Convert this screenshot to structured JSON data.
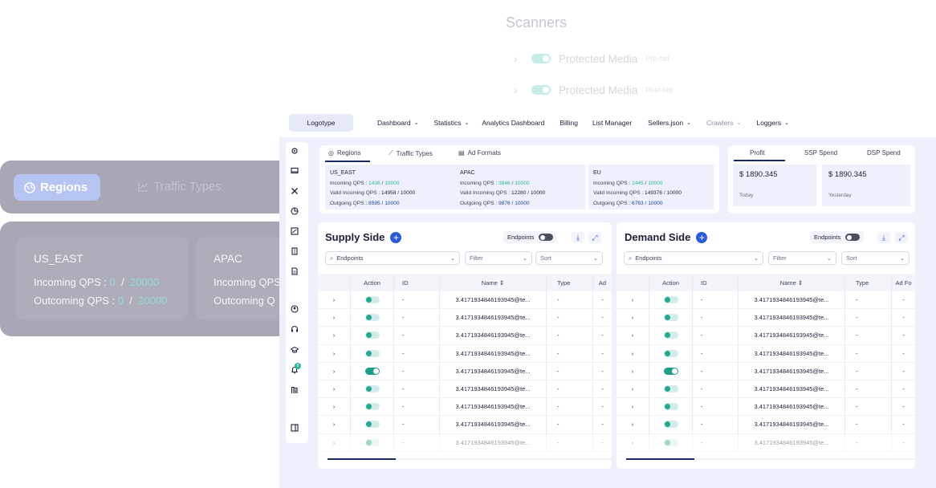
{
  "scanners": {
    "title": "Scanners",
    "rows": [
      {
        "label": "Protected Media",
        "tag": "Pre-bid"
      },
      {
        "label": "Protected Media",
        "tag": "Post-bid"
      }
    ]
  },
  "zoom": {
    "tabs": [
      "Regions",
      "Traffic Types"
    ],
    "cards": [
      {
        "region": "US_EAST",
        "incoming_label": "Incoming QPS :",
        "incoming": "0",
        "incoming_max": "20000",
        "outcoming_label": "Outcoming QPS :",
        "outcoming": "0",
        "outcoming_max": "20000"
      },
      {
        "region": "APAC",
        "incoming_label": "Incoming QPS",
        "outcoming_label": "Outcoming Q"
      }
    ]
  },
  "nav": {
    "logo": "Logotype",
    "items": [
      "Dashboard",
      "Statistics",
      "Analytics Dashboard",
      "Billing",
      "List Manager",
      "Sellers.json",
      "Crawlers",
      "Loggers"
    ]
  },
  "regions_card": {
    "tabs": [
      "Regions",
      "Traffic Types",
      "Ad Formats"
    ],
    "regions": [
      {
        "name": "US_EAST",
        "incoming_label": "Incoming QPS :",
        "incoming": "1436",
        "incoming_max": "10000",
        "valid_label": "Valid Incoming QPS :",
        "valid": "14958",
        "valid_max": "10000",
        "outgoing_label": "Outgoing QPS :",
        "outgoing": "8595",
        "outgoing_max": "10000"
      },
      {
        "name": "APAC",
        "incoming_label": "Incoming QPS :",
        "incoming": "3846",
        "incoming_max": "10000",
        "valid_label": "Valid Incoming QPS :",
        "valid": "12280",
        "valid_max": "10000",
        "outgoing_label": "Outgoing QPS :",
        "outgoing": "9876",
        "outgoing_max": "10000"
      },
      {
        "name": "EU",
        "incoming_label": "Incoming QPS :",
        "incoming": "2445",
        "incoming_max": "10000",
        "valid_label": "Valid Incoming QPS :",
        "valid": "149376",
        "valid_max": "10000",
        "outgoing_label": "Outgoing QPS :",
        "outgoing": "6763",
        "outgoing_max": "10000"
      }
    ]
  },
  "profit_card": {
    "tabs": [
      "Profit",
      "SSP Spend",
      "DSP Spend"
    ],
    "boxes": [
      {
        "value": "$ 1890.345",
        "label": "Today"
      },
      {
        "value": "$ 1890.345",
        "label": "Yesterday"
      }
    ]
  },
  "supply": {
    "title": "Supply Side",
    "endpoints_label": "Endpoints",
    "endpoints_placeholder": "Endpoints",
    "filter": "Filter",
    "sort": "Sort",
    "columns": [
      "Action",
      "ID",
      "Name",
      "Type",
      "Ad"
    ],
    "rows": [
      {
        "id": "-",
        "name": "3.4171934846193945@te...",
        "type": "-",
        "ad": "-",
        "on": false
      },
      {
        "id": "-",
        "name": "3.4171934846193945@te...",
        "type": "-",
        "ad": "-",
        "on": false
      },
      {
        "id": "-",
        "name": "3.4171934846193945@te...",
        "type": "-",
        "ad": "-",
        "on": false
      },
      {
        "id": "-",
        "name": "3.4171934846193945@te...",
        "type": "-",
        "ad": "-",
        "on": false
      },
      {
        "id": "-",
        "name": "3.4171934846193945@te...",
        "type": "-",
        "ad": "-",
        "on": true
      },
      {
        "id": "-",
        "name": "3.4171934846193945@te...",
        "type": "-",
        "ad": "-",
        "on": false
      },
      {
        "id": "-",
        "name": "3.4171934846193945@te...",
        "type": "-",
        "ad": "-",
        "on": false
      },
      {
        "id": "-",
        "name": "3.4171934846193945@te...",
        "type": "-",
        "ad": "-",
        "on": false
      },
      {
        "id": "-",
        "name": "3.4171934846193945@te...",
        "type": "-",
        "ad": "-",
        "on": false
      }
    ]
  },
  "demand": {
    "title": "Demand Side",
    "endpoints_label": "Endpoints",
    "endpoints_placeholder": "Endpoints",
    "filter": "Filter",
    "sort": "Sort",
    "columns": [
      "Action",
      "ID",
      "Name",
      "Type",
      "Ad Fo"
    ],
    "rows": [
      {
        "id": "-",
        "name": "3.4171934846193945@te...",
        "type": "-",
        "ad": "-",
        "on": false
      },
      {
        "id": "-",
        "name": "3.4171934846193945@te...",
        "type": "-",
        "ad": "-",
        "on": false
      },
      {
        "id": "-",
        "name": "3.4171934846193945@te...",
        "type": "-",
        "ad": "-",
        "on": false
      },
      {
        "id": "-",
        "name": "3.4171934846193945@te...",
        "type": "-",
        "ad": "-",
        "on": false
      },
      {
        "id": "-",
        "name": "3.4171934846193945@te...",
        "type": "-",
        "ad": "-",
        "on": true
      },
      {
        "id": "-",
        "name": "3.4171934846193945@te...",
        "type": "-",
        "ad": "-",
        "on": false
      },
      {
        "id": "-",
        "name": "3.4171934846193945@te...",
        "type": "-",
        "ad": "-",
        "on": false
      },
      {
        "id": "-",
        "name": "3.4171934846193945@te...",
        "type": "-",
        "ad": "-",
        "on": false
      },
      {
        "id": "-",
        "name": "3.4171934846193945@te...",
        "type": "-",
        "ad": "-",
        "on": false
      }
    ]
  },
  "notification_count": "8",
  "colors": {
    "accent": "#2a5bdb",
    "navy": "#1a2a5e",
    "green": "#2bb49b"
  }
}
